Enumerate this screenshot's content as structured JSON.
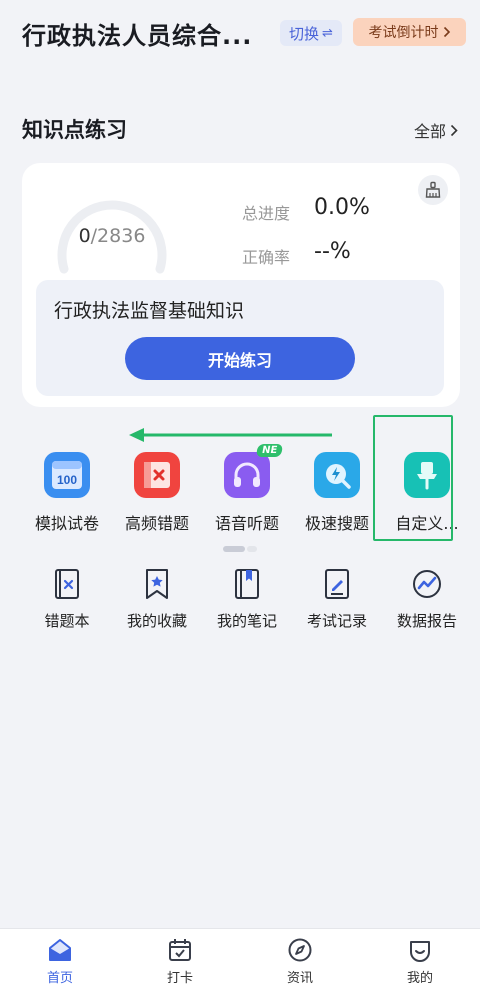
{
  "header": {
    "title": "行政执法人员综合...",
    "switch_label": "切换",
    "countdown_label": "考试倒计时"
  },
  "section": {
    "title": "知识点练习",
    "all_label": "全部"
  },
  "progress": {
    "done": "0",
    "total": "/2836",
    "progress_label": "总进度",
    "progress_value": "0.0%",
    "accuracy_label": "正确率",
    "accuracy_value": "--%",
    "completion_fraction": 0.0
  },
  "practice": {
    "subject": "行政执法监督基础知识",
    "start_label": "开始练习"
  },
  "tools": [
    {
      "label": "模拟试卷",
      "icon": "exam-paper-100-icon",
      "color": "#3a8ef0"
    },
    {
      "label": "高频错题",
      "icon": "wrong-question-icon",
      "color": "#f0443f"
    },
    {
      "label": "语音听题",
      "icon": "headphones-icon",
      "color": "#8a5cf0",
      "badge": "NE"
    },
    {
      "label": "极速搜题",
      "icon": "fast-search-icon",
      "color": "#2aa8e8"
    },
    {
      "label": "自定义...",
      "icon": "pin-icon",
      "color": "#17c1b5"
    }
  ],
  "shortcuts": [
    {
      "label": "错题本",
      "icon": "wrong-book-icon"
    },
    {
      "label": "我的收藏",
      "icon": "bookmark-icon"
    },
    {
      "label": "我的笔记",
      "icon": "notebook-icon"
    },
    {
      "label": "考试记录",
      "icon": "exam-record-icon"
    },
    {
      "label": "数据报告",
      "icon": "data-report-icon"
    }
  ],
  "tabbar": [
    {
      "label": "首页",
      "icon": "home-icon",
      "active": true
    },
    {
      "label": "打卡",
      "icon": "calendar-check-icon",
      "active": false
    },
    {
      "label": "资讯",
      "icon": "compass-icon",
      "active": false
    },
    {
      "label": "我的",
      "icon": "profile-icon",
      "active": false
    }
  ],
  "colors": {
    "accent": "#3d64e0",
    "highlight": "#26b86a",
    "background": "#f2f3f7"
  }
}
